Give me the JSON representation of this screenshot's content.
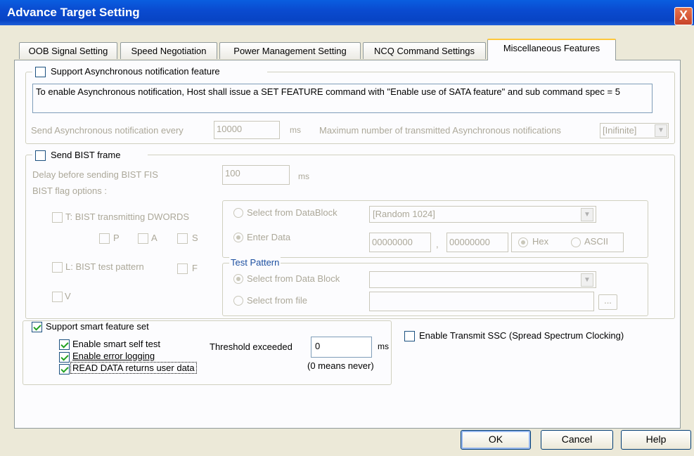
{
  "window": {
    "title": "Advance Target Setting",
    "close_label": "X"
  },
  "tabs": [
    "OOB Signal Setting",
    "Speed Negotiation",
    "Power Management Setting",
    "NCQ Command Settings",
    "Miscellaneous Features"
  ],
  "async": {
    "label": "Support Asynchronous notification feature",
    "info": "To enable Asynchronous notification, Host shall issue a SET FEATURE command with \"Enable use of SATA feature\" and sub command spec = 5",
    "every_label": "Send Asynchronous notification every",
    "every_value": "10000",
    "every_unit": "ms",
    "max_label": "Maximum number of transmitted Asynchronous notifications",
    "max_value": "[Inifinite]"
  },
  "bist": {
    "label": "Send BIST frame",
    "delay_label": "Delay before sending BIST FIS",
    "delay_value": "100",
    "delay_unit": "ms",
    "flag_label": "BIST flag options :",
    "t_label": "T: BIST transmitting DWORDS",
    "p": "P",
    "a": "A",
    "s": "S",
    "l_label": "L: BIST test pattern",
    "f": "F",
    "v": "V",
    "select_datablock": "Select from DataBlock",
    "datablock_value": "[Random 1024]",
    "enter_data": "Enter Data",
    "data1": "00000000",
    "comma": ",",
    "data2": "00000000",
    "hex": "Hex",
    "ascii": "ASCII",
    "test_pattern_label": "Test Pattern",
    "select_data_block": "Select from Data Block",
    "select_file": "Select from file",
    "browse": "..."
  },
  "smart": {
    "label": "Support smart feature set",
    "self_test": "Enable smart self test",
    "error_logging": "Enable error logging",
    "read_data": "READ DATA returns user data",
    "threshold_label": "Threshold exceeded",
    "threshold_value": "0",
    "threshold_unit": "ms",
    "never_note": "(0 means never)"
  },
  "ssc": {
    "label": "Enable Transmit SSC (Spread Spectrum Clocking)"
  },
  "buttons": {
    "ok": "OK",
    "cancel": "Cancel",
    "help": "Help"
  }
}
